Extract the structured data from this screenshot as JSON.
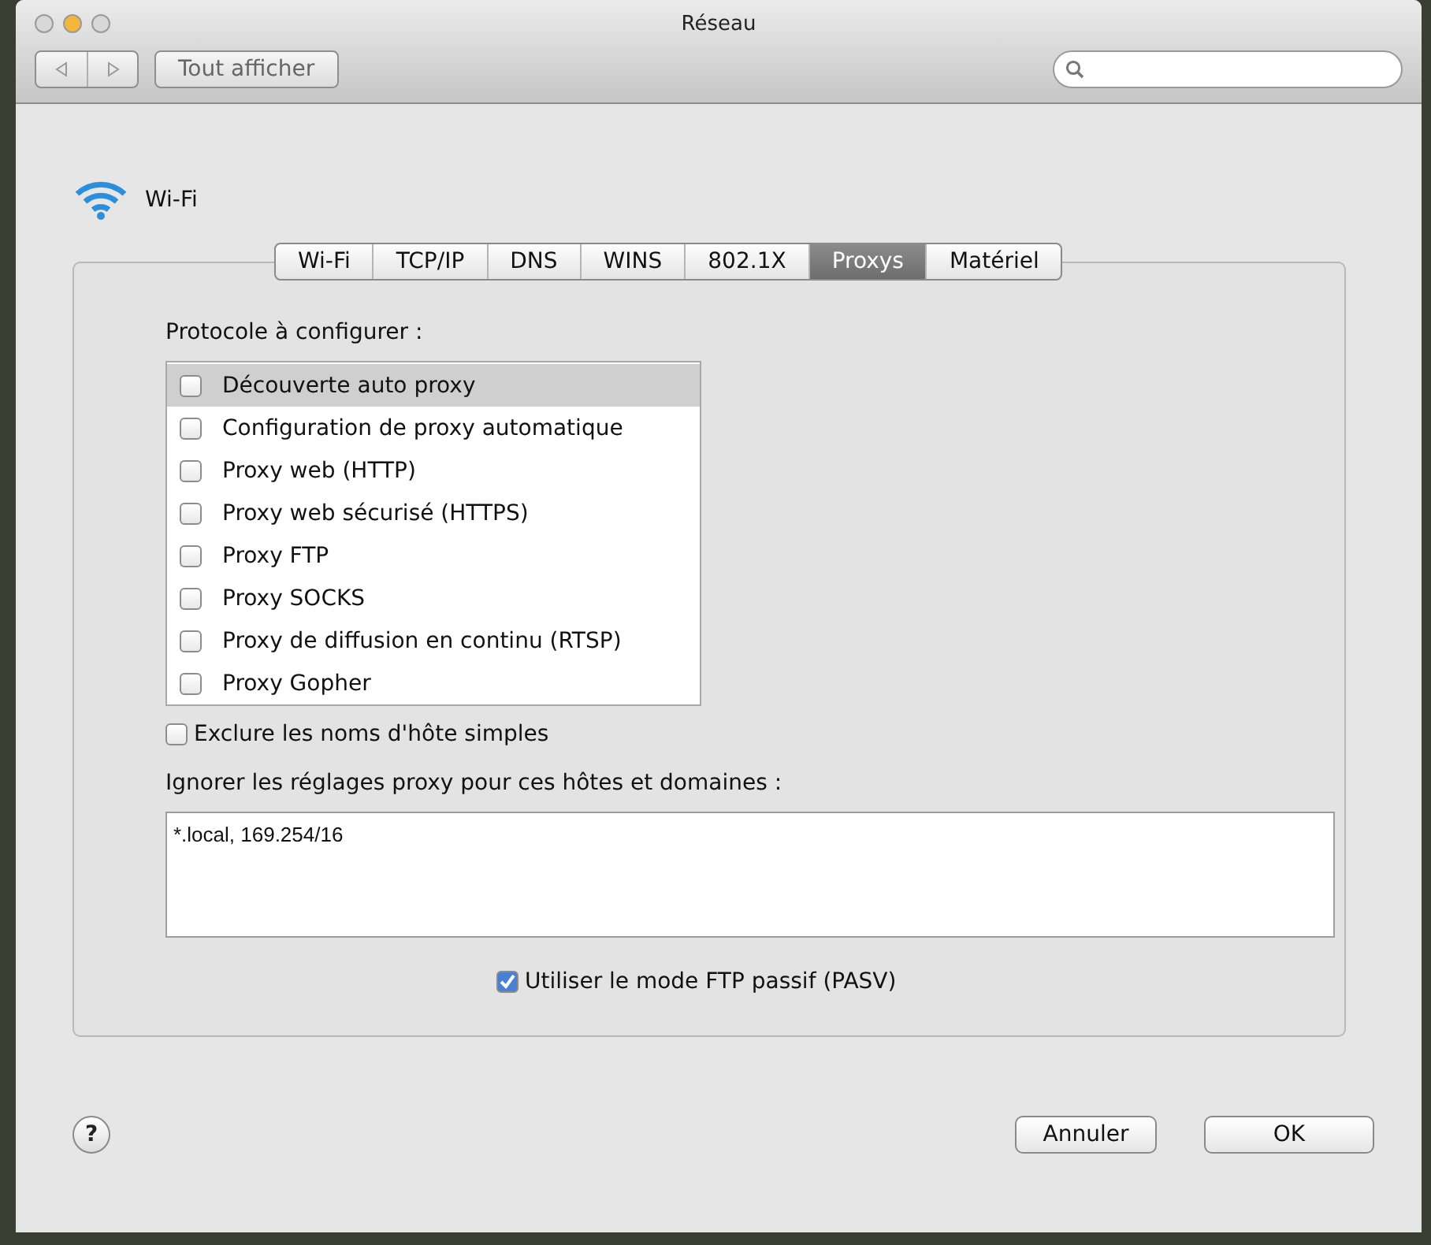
{
  "window": {
    "title": "Réseau",
    "show_all_button": "Tout afficher"
  },
  "interface": {
    "name": "Wi-Fi"
  },
  "tabs": [
    {
      "label": "Wi-Fi",
      "selected": false
    },
    {
      "label": "TCP/IP",
      "selected": false
    },
    {
      "label": "DNS",
      "selected": false
    },
    {
      "label": "WINS",
      "selected": false
    },
    {
      "label": "802.1X",
      "selected": false
    },
    {
      "label": "Proxys",
      "selected": true
    },
    {
      "label": "Matériel",
      "selected": false
    }
  ],
  "protocols": {
    "label": "Protocole à configurer :",
    "items": [
      {
        "label": "Découverte auto proxy",
        "checked": false,
        "selected": true
      },
      {
        "label": "Configuration de proxy automatique",
        "checked": false,
        "selected": false
      },
      {
        "label": "Proxy web (HTTP)",
        "checked": false,
        "selected": false
      },
      {
        "label": "Proxy web sécurisé (HTTPS)",
        "checked": false,
        "selected": false
      },
      {
        "label": "Proxy FTP",
        "checked": false,
        "selected": false
      },
      {
        "label": "Proxy SOCKS",
        "checked": false,
        "selected": false
      },
      {
        "label": "Proxy de diffusion en continu (RTSP)",
        "checked": false,
        "selected": false
      },
      {
        "label": "Proxy Gopher",
        "checked": false,
        "selected": false
      }
    ]
  },
  "exclude_simple": {
    "label": "Exclure les noms d'hôte simples",
    "checked": false
  },
  "bypass": {
    "label": "Ignorer les réglages proxy pour ces hôtes et domaines :",
    "value": "*.local, 169.254/16"
  },
  "passive_ftp": {
    "label": "Utiliser le mode FTP passif (PASV)",
    "checked": true
  },
  "buttons": {
    "help": "?",
    "cancel": "Annuler",
    "ok": "OK"
  }
}
